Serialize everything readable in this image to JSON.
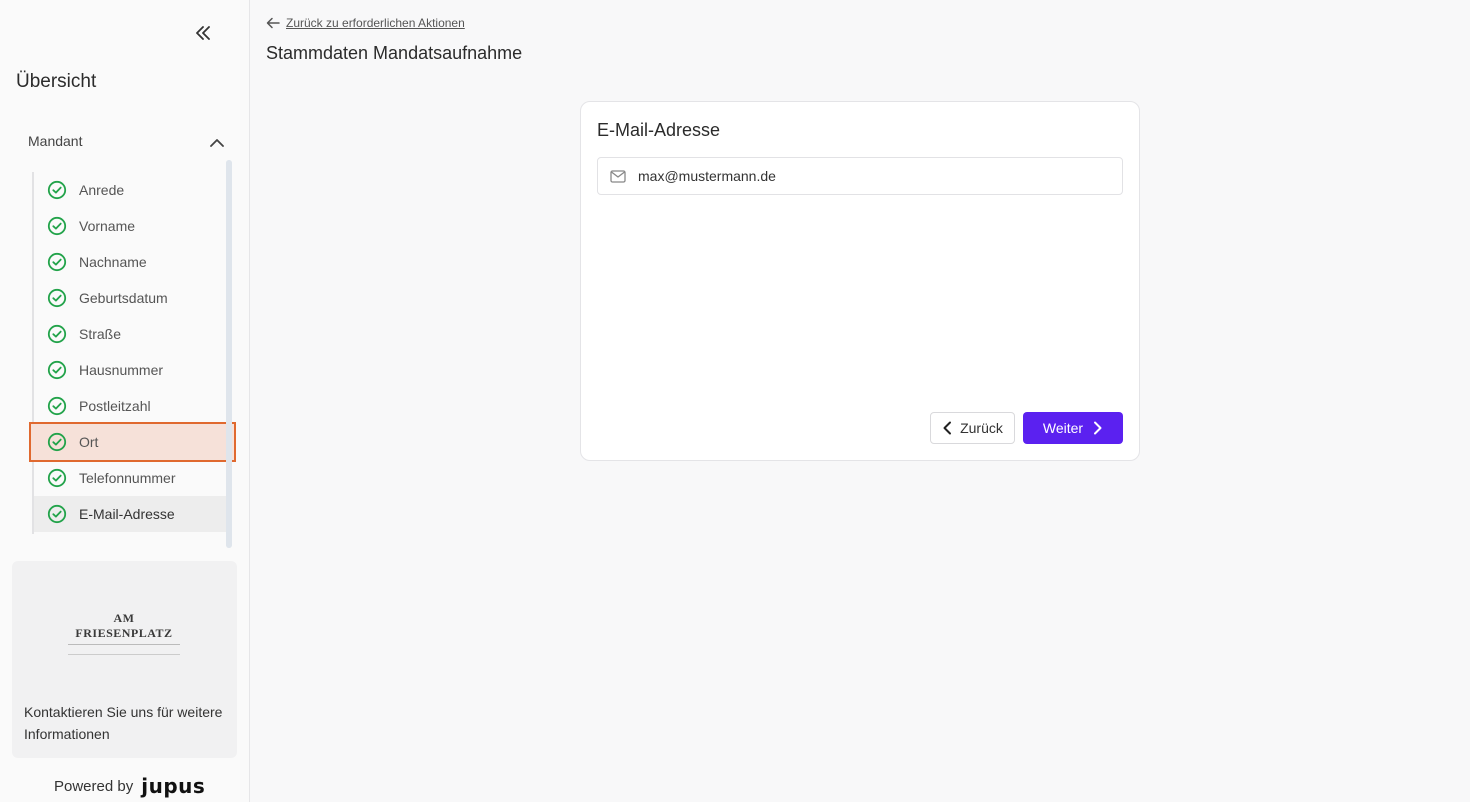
{
  "sidebar": {
    "overview_title": "Übersicht",
    "section": {
      "label": "Mandant",
      "expanded": true
    },
    "items": [
      {
        "label": "Anrede",
        "status": "complete"
      },
      {
        "label": "Vorname",
        "status": "complete"
      },
      {
        "label": "Nachname",
        "status": "complete"
      },
      {
        "label": "Geburtsdatum",
        "status": "complete"
      },
      {
        "label": "Straße",
        "status": "complete"
      },
      {
        "label": "Hausnummer",
        "status": "complete"
      },
      {
        "label": "Postleitzahl",
        "status": "complete"
      },
      {
        "label": "Ort",
        "status": "complete"
      },
      {
        "label": "Telefonnummer",
        "status": "complete"
      },
      {
        "label": "E-Mail-Adresse",
        "status": "complete"
      }
    ],
    "contact": {
      "logo_name": "AM FRIESENPLATZ",
      "text": "Kontaktieren Sie uns für weitere Informationen"
    },
    "powered_by": {
      "label": "Powered by",
      "brand": "jupus"
    }
  },
  "main": {
    "back_link": "Zurück zu erforderlichen Aktionen",
    "page_title": "Stammdaten Mandatsaufnahme",
    "card": {
      "title": "E-Mail-Adresse",
      "email_value": "max@mustermann.de",
      "back_button": "Zurück",
      "next_button": "Weiter"
    }
  },
  "colors": {
    "accent": "#5b21f0",
    "check": "#22a34a",
    "highlight_border": "#e0692f",
    "highlight_fill": "#f6e1d9"
  }
}
